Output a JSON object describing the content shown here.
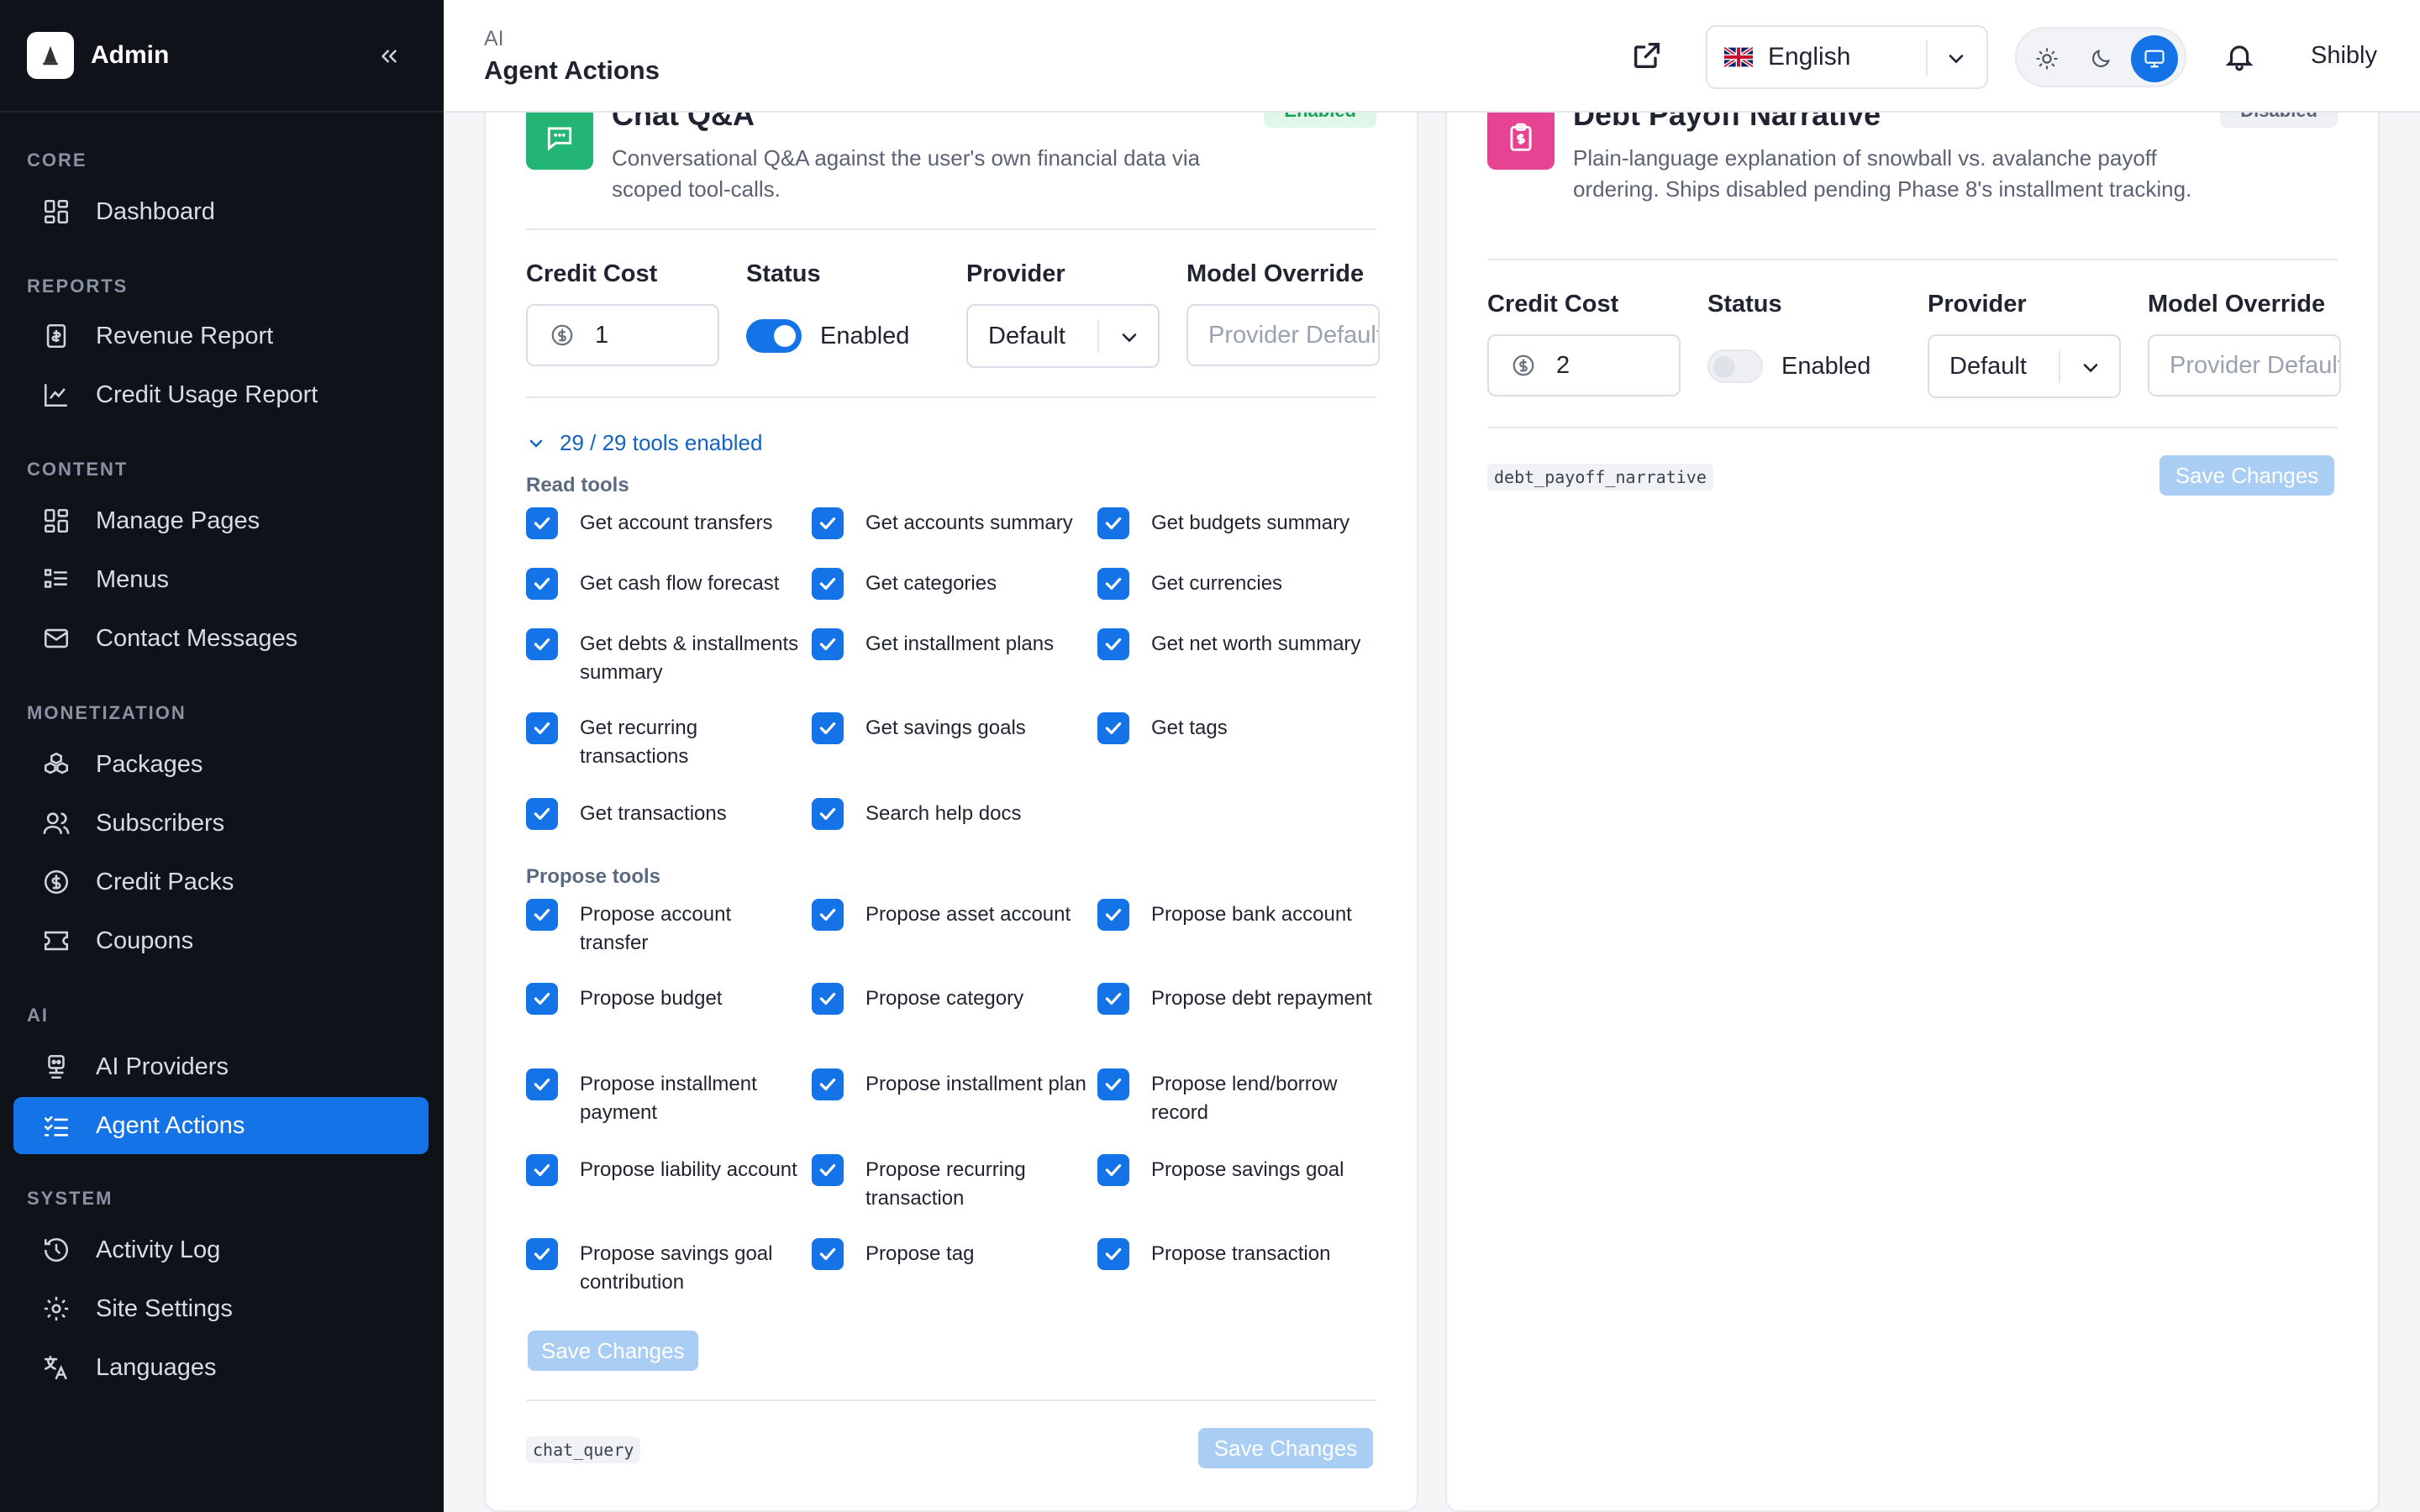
{
  "sidebar": {
    "brand": "Admin",
    "sections": {
      "core": "CORE",
      "reports": "REPORTS",
      "content": "CONTENT",
      "monetization": "MONETIZATION",
      "ai": "AI",
      "system": "SYSTEM"
    },
    "items": {
      "dashboard": "Dashboard",
      "revenue_report": "Revenue Report",
      "credit_usage_report": "Credit Usage Report",
      "manage_pages": "Manage Pages",
      "menus": "Menus",
      "contact_messages": "Contact Messages",
      "packages": "Packages",
      "subscribers": "Subscribers",
      "credit_packs": "Credit Packs",
      "coupons": "Coupons",
      "ai_providers": "AI Providers",
      "agent_actions": "Agent Actions",
      "activity_log": "Activity Log",
      "site_settings": "Site Settings",
      "languages": "Languages"
    },
    "active_item": "agent_actions",
    "active_color": "#1473e6"
  },
  "header": {
    "breadcrumb_parent": "AI",
    "page_title": "Agent Actions",
    "language": "English",
    "user_name": "Shibly",
    "theme_selected": "system"
  },
  "cards": {
    "chat": {
      "title": "Chat Q&A",
      "description": "Conversational Q&A against the user's own financial data via scoped tool-calls.",
      "badge": "Enabled",
      "icon": "chat-bubble-icon",
      "icon_color": "#22b573",
      "labels": {
        "credit_cost": "Credit Cost",
        "status": "Status",
        "provider": "Provider",
        "model_override": "Model Override"
      },
      "credit_cost": "1",
      "status_enabled": true,
      "status_label": "Enabled",
      "provider": "Default",
      "model_placeholder": "Provider Default",
      "tools_summary": "29 / 29 tools enabled",
      "read_label": "Read tools",
      "read_tools": [
        "Get account transfers",
        "Get accounts summary",
        "Get budgets summary",
        "Get cash flow forecast",
        "Get categories",
        "Get currencies",
        "Get debts & installments summary",
        "Get installment plans",
        "Get net worth summary",
        "Get recurring transactions",
        "Get savings goals",
        "Get tags",
        "Get transactions",
        "Search help docs"
      ],
      "propose_label": "Propose tools",
      "propose_tools": [
        "Propose account transfer",
        "Propose asset account",
        "Propose bank account",
        "Propose budget",
        "Propose category",
        "Propose debt repayment",
        "Propose installment payment",
        "Propose installment plan",
        "Propose lend/borrow record",
        "Propose liability account",
        "Propose recurring transaction",
        "Propose savings goal",
        "Propose savings goal contribution",
        "Propose tag",
        "Propose transaction"
      ],
      "tools_save": "Save Changes",
      "slug": "chat_query",
      "save": "Save Changes"
    },
    "debt": {
      "title": "Debt Payoff Narrative",
      "description": "Plain-language explanation of snowball vs. avalanche payoff ordering. Ships disabled pending Phase 8's installment tracking.",
      "badge": "Disabled",
      "icon": "clipboard-dollar-icon",
      "icon_color": "#e84393",
      "labels": {
        "credit_cost": "Credit Cost",
        "status": "Status",
        "provider": "Provider",
        "model_override": "Model Override"
      },
      "credit_cost": "2",
      "status_enabled": false,
      "status_label": "Enabled",
      "provider": "Default",
      "model_placeholder": "Provider Default",
      "slug": "debt_payoff_narrative",
      "save": "Save Changes"
    }
  }
}
